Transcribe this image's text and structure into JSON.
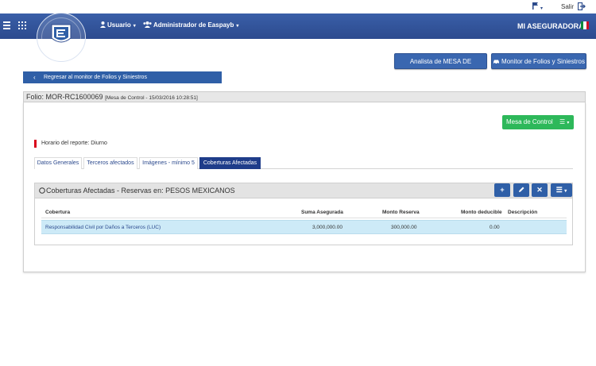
{
  "topbar": {
    "logout_label": "Salir"
  },
  "navbar": {
    "user_menu": "Usuario",
    "admin_menu": "Administrador de Easpayb",
    "company": "MI ASEGURADORA"
  },
  "actions": {
    "analista_btn": "Analista de MESA DE CONTROL",
    "monitor_btn": "Monitor de Folios y Siniestros"
  },
  "back_link": "Regresar al monitor de Folios y Siniestros",
  "folio": {
    "label": "Folio: MOR-RC1600069",
    "meta": "[Mesa de Control - 15/03/2016 10:28:51]"
  },
  "mesa_control_btn": "Mesa de Control",
  "horario": "Horario del reporte: Diurno",
  "tabs": [
    {
      "label": "Datos Generales"
    },
    {
      "label": "Terceros afectados"
    },
    {
      "label": "Imágenes - mínimo 5"
    },
    {
      "label": "Coberturas Afectadas"
    }
  ],
  "panel": {
    "title": "Coberturas Afectadas - Reservas en: PESOS MEXICANOS",
    "columns": [
      "Cobertura",
      "Suma Asegurada",
      "Monto Reserva",
      "Monto deducible",
      "Descripción"
    ],
    "rows": [
      [
        "Responsabilidad Civil por Daños a Terceros (LUC)",
        "3,000,000.00",
        "300,000.00",
        "0.00",
        ""
      ]
    ]
  },
  "colors": {
    "navbar": "#2f5199",
    "primary": "#2f5fa7",
    "success": "#2db85a",
    "active_tab": "#1f3d8a",
    "row_highlight": "#cdeaf7",
    "accent_red": "#d9001b"
  }
}
